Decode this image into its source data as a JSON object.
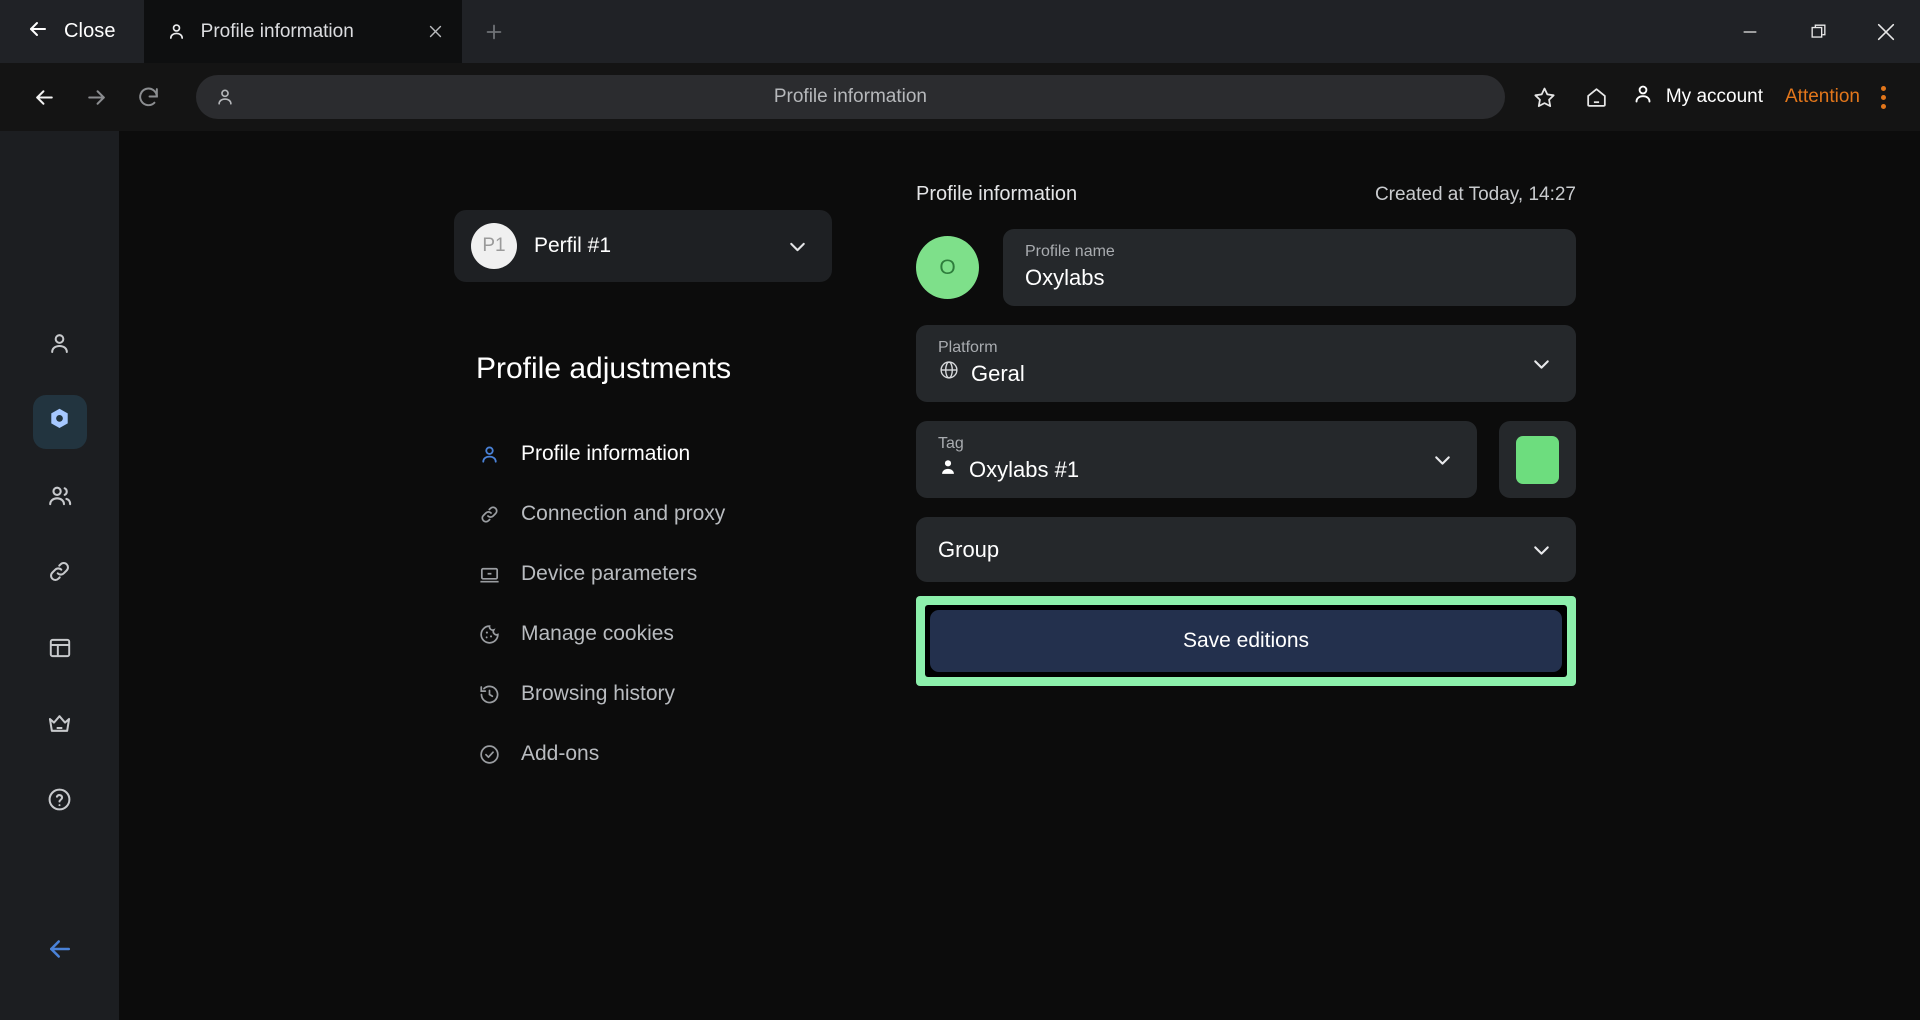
{
  "window": {
    "close_label": "Close",
    "controls": {
      "minimize": "minimize-icon",
      "maximize": "maximize-icon",
      "close": "close-icon"
    }
  },
  "tabs": [
    {
      "title": "Profile information",
      "favicon": "person-icon",
      "close": "close-icon",
      "active": true
    }
  ],
  "newtab_label": "+",
  "toolbar": {
    "back": "back-arrow-icon",
    "forward": "forward-arrow-icon",
    "reload": "reload-icon",
    "url_value": "Profile information",
    "url_icon": "person-icon",
    "bookmark": "star-icon",
    "home": "home-icon",
    "account_label": "My account",
    "account_icon": "person-icon",
    "attention_label": "Attention",
    "menu_icon": "kebab-menu-icon"
  },
  "rail": {
    "items": [
      {
        "name": "sidebar-item-account",
        "icon": "person-icon",
        "active": false
      },
      {
        "name": "sidebar-item-profiles",
        "icon": "hexagon-settings-icon",
        "active": true
      },
      {
        "name": "sidebar-item-team",
        "icon": "people-icon",
        "active": false
      },
      {
        "name": "sidebar-item-proxies",
        "icon": "link-icon",
        "active": false
      },
      {
        "name": "sidebar-item-workspace",
        "icon": "layout-panel-icon",
        "active": false
      },
      {
        "name": "sidebar-item-premium",
        "icon": "crown-icon",
        "active": false
      },
      {
        "name": "sidebar-item-help",
        "icon": "help-circle-icon",
        "active": false
      }
    ],
    "collapse": "back-arrow-icon"
  },
  "profile_selector": {
    "avatar_initials": "P1",
    "name": "Perfil #1",
    "chevron": "chevron-down-icon"
  },
  "adjustments": {
    "heading": "Profile adjustments",
    "items": [
      {
        "label": "Profile information",
        "icon": "person-icon",
        "active": true
      },
      {
        "label": "Connection and proxy",
        "icon": "link-icon",
        "active": false
      },
      {
        "label": "Device parameters",
        "icon": "laptop-icon",
        "active": false
      },
      {
        "label": "Manage cookies",
        "icon": "cookie-icon",
        "active": false
      },
      {
        "label": "Browsing history",
        "icon": "history-clock-icon",
        "active": false
      },
      {
        "label": "Add-ons",
        "icon": "check-circle-icon",
        "active": false
      }
    ]
  },
  "panel": {
    "title": "Profile information",
    "created_at": "Created at Today, 14:27",
    "avatar_initial": "O",
    "avatar_color": "#7ee08a",
    "fields": {
      "profile_name": {
        "label": "Profile name",
        "value": "Oxylabs"
      },
      "platform": {
        "label": "Platform",
        "value": "Geral",
        "icon": "globe-icon",
        "chevron": "chevron-down-icon"
      },
      "tag": {
        "label": "Tag",
        "value": "Oxylabs #1",
        "icon": "person-filled-icon",
        "chevron": "chevron-down-icon"
      },
      "tag_color": "#6ddd7e",
      "group": {
        "label": "Group",
        "value": "",
        "chevron": "chevron-down-icon"
      }
    },
    "save_label": "Save editions",
    "highlight_color": "#8df0ac"
  }
}
